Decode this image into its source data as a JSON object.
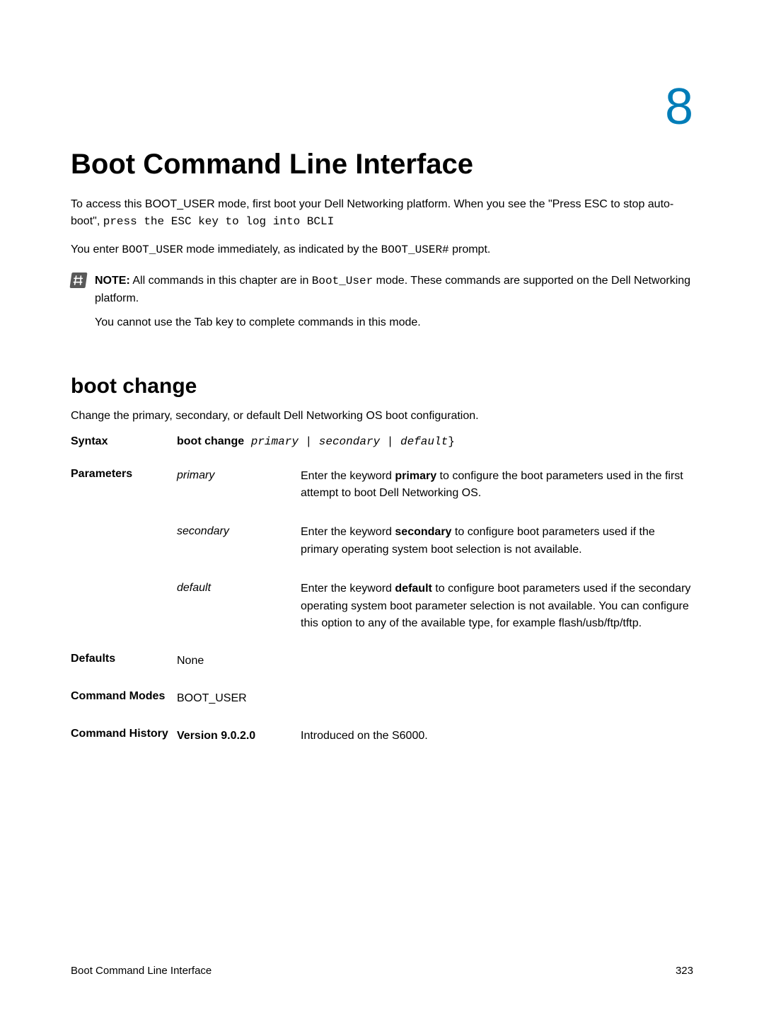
{
  "chapterNumber": "8",
  "title": "Boot Command Line Interface",
  "intro1a": "To access this BOOT_USER mode, first boot your Dell Networking platform. When you see the \"Press ESC to stop auto-boot\", ",
  "intro1b": "press the ESC key to log into BCLI",
  "intro2a": "You enter ",
  "intro2b": "BOOT_USER",
  "intro2c": " mode immediately, as indicated by the ",
  "intro2d": "BOOT_USER#",
  "intro2e": " prompt.",
  "noteLabel": "NOTE:",
  "noteText1a": " All commands in this chapter are in ",
  "noteText1b": "Boot_User",
  "noteText1c": " mode. These commands are supported on the Dell Networking platform.",
  "noteFollow": "You cannot use the Tab key to complete commands in this mode.",
  "h2": "boot change",
  "h2desc": "Change the primary, secondary, or default Dell Networking OS boot configuration.",
  "syntaxLabel": "Syntax",
  "syntaxBold": "boot change",
  "syntaxItalic1": " primary",
  "syntaxPipe1": " | ",
  "syntaxItalic2": "secondary",
  "syntaxPipe2": " | ",
  "syntaxItalic3": "default",
  "syntaxBrace": "}",
  "paramsLabel": "Parameters",
  "params": [
    {
      "key": "primary",
      "descPre": "Enter the keyword ",
      "descBold": "primary",
      "descPost": " to configure the boot parameters used in the first attempt to boot Dell Networking OS."
    },
    {
      "key": "secondary",
      "descPre": "Enter the keyword ",
      "descBold": "secondary",
      "descPost": " to configure boot parameters used if the primary operating system boot selection is not available."
    },
    {
      "key": "default",
      "descPre": "Enter the keyword ",
      "descBold": "default",
      "descPost": " to configure boot parameters used if the secondary operating system boot parameter selection is not available. You can configure this option to any of the available type, for example flash/usb/ftp/tftp."
    }
  ],
  "defaultsLabel": "Defaults",
  "defaultsVal": "None",
  "cmdModesLabel": "Command Modes",
  "cmdModesVal": "BOOT_USER",
  "cmdHistLabel": "Command History",
  "cmdHistKey": "Version 9.0.2.0",
  "cmdHistVal": "Introduced on the S6000.",
  "footerLeft": "Boot Command Line Interface",
  "footerRight": "323"
}
